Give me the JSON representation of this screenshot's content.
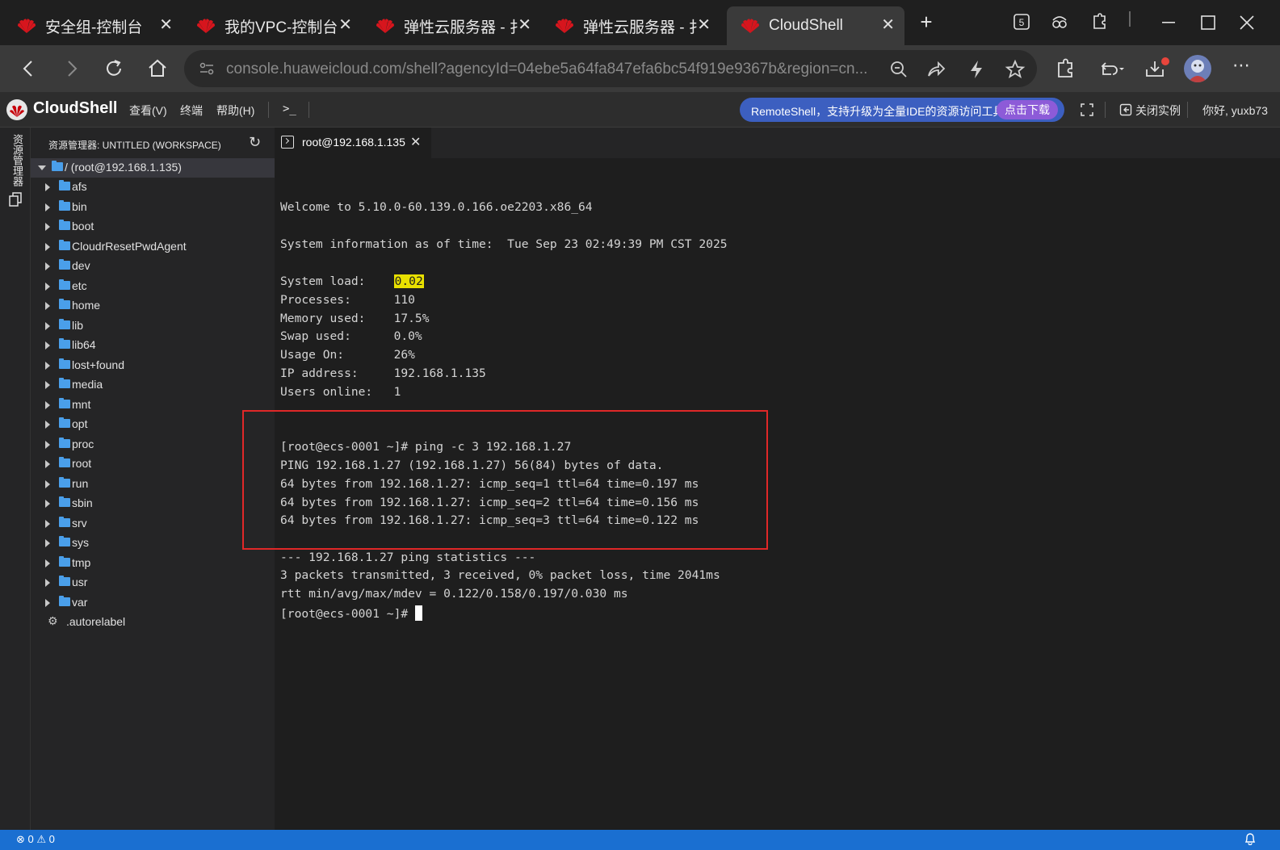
{
  "browser": {
    "tabs": [
      {
        "title": "安全组-控制台",
        "close": "✕"
      },
      {
        "title": "我的VPC-控制台",
        "close": "✕"
      },
      {
        "title": "弹性云服务器 - 扌",
        "close": "✕"
      },
      {
        "title": "弹性云服务器 - 扌",
        "close": "✕"
      },
      {
        "title": "CloudShell",
        "close": "✕"
      }
    ],
    "new_tab": "+",
    "address_url": "console.huaweicloud.com/shell?agencyId=04ebe5a64fa847efa6bc54f919e9367b&region=cn...",
    "icons": [
      "back-icon",
      "forward-icon",
      "reload-icon",
      "home-icon",
      "zoom-out-icon",
      "share-icon",
      "performance-icon",
      "favorite-icon",
      "extensions-icon",
      "back-history-icon",
      "downloads-icon",
      "profile-avatar",
      "more-icon"
    ],
    "brand_color": "#c7000b"
  },
  "cloudshell": {
    "brand": "CloudShell",
    "menus": {
      "view": "查看(V)",
      "terminal": "终端",
      "help": "帮助(H)"
    },
    "prompt_icon": ">_",
    "promo": {
      "text": "RemoteShell，支持升级为全量IDE的资源访问工具",
      "button": "点击下载"
    },
    "close_instance": "关闭实例",
    "greeting": "你好, yuxb73",
    "accent_color": "#3c5fc0"
  },
  "activity": {
    "explorer_label": "资源管理器"
  },
  "explorer": {
    "title": "资源管理器: UNTITLED (WORKSPACE)",
    "root": "/ (root@192.168.1.135)",
    "folders": [
      "afs",
      "bin",
      "boot",
      "CloudrResetPwdAgent",
      "dev",
      "etc",
      "home",
      "lib",
      "lib64",
      "lost+found",
      "media",
      "mnt",
      "opt",
      "proc",
      "root",
      "run",
      "sbin",
      "srv",
      "sys",
      "tmp",
      "usr",
      "var"
    ],
    "files": [
      ".autorelabel"
    ]
  },
  "terminal": {
    "tab_title": "root@192.168.1.135",
    "welcome": "Welcome to 5.10.0-60.139.0.166.oe2203.x86_64",
    "sysinfo": "System information as of time:  Tue Sep 23 02:49:39 PM CST 2025",
    "stats": {
      "load_label": "System load:    ",
      "load_value": "0.02",
      "processes": "Processes:      110",
      "memory": "Memory used:    17.5%",
      "swap": "Swap used:      0.0%",
      "usage": "Usage On:       26%",
      "ip": "IP address:     192.168.1.135",
      "users": "Users online:   1"
    },
    "ping_command": "[root@ecs-0001 ~]# ping -c 3 192.168.1.27",
    "ping_header": "PING 192.168.1.27 (192.168.1.27) 56(84) bytes of data.",
    "ping_replies": [
      "64 bytes from 192.168.1.27: icmp_seq=1 ttl=64 time=0.197 ms",
      "64 bytes from 192.168.1.27: icmp_seq=2 ttl=64 time=0.156 ms",
      "64 bytes from 192.168.1.27: icmp_seq=3 ttl=64 time=0.122 ms"
    ],
    "stats_header": "--- 192.168.1.27 ping statistics ---",
    "stats_summary": "3 packets transmitted, 3 received, 0% packet loss, time 2041ms",
    "rtt": "rtt min/avg/max/mdev = 0.122/0.158/0.197/0.030 ms",
    "prompt": "[root@ecs-0001 ~]# ",
    "highlight_box_color": "#e02828"
  },
  "statusbar": {
    "errors": "0",
    "warnings": "0",
    "bell_icon": "bell-icon"
  }
}
